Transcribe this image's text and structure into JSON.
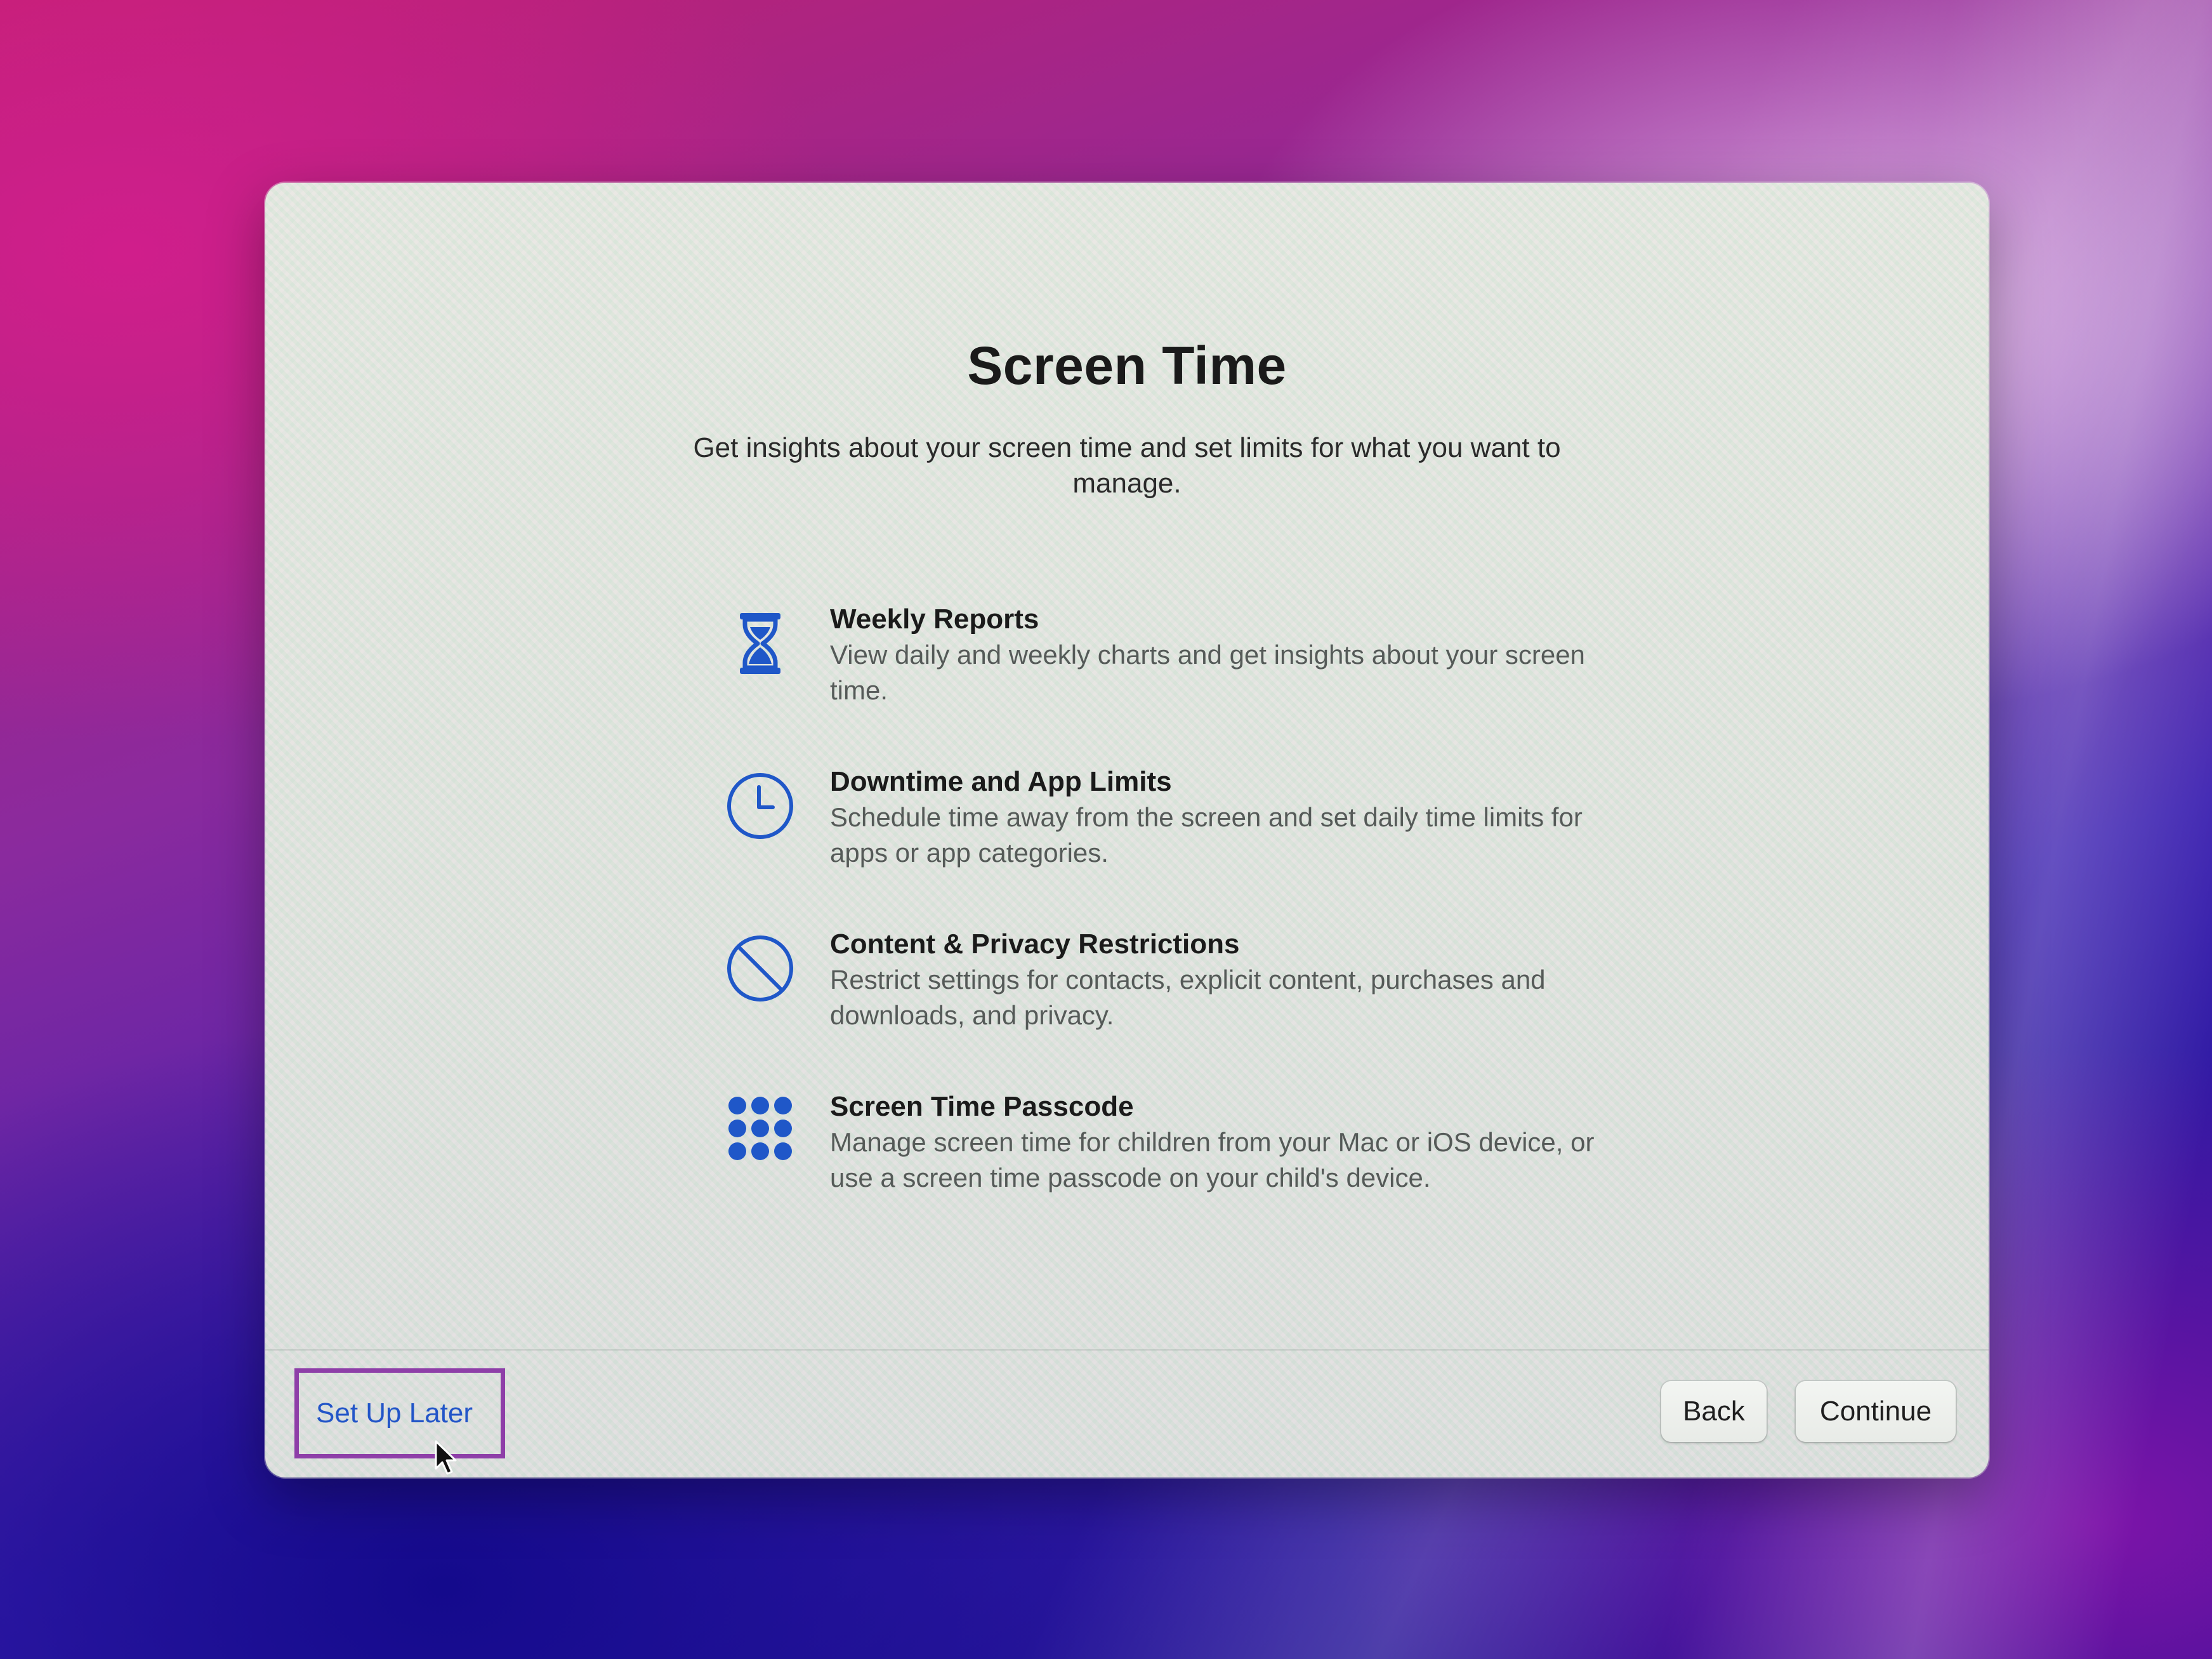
{
  "dialog": {
    "title": "Screen Time",
    "subtitle": "Get insights about your screen time and set limits for what you want to manage."
  },
  "features": [
    {
      "icon": "hourglass-icon",
      "title": "Weekly Reports",
      "description": "View daily and weekly charts and get insights about your screen time."
    },
    {
      "icon": "clock-icon",
      "title": "Downtime and App Limits",
      "description": "Schedule time away from the screen and set daily time limits for apps or app categories."
    },
    {
      "icon": "prohibited-icon",
      "title": "Content & Privacy Restrictions",
      "description": "Restrict settings for contacts, explicit content, purchases and downloads, and privacy."
    },
    {
      "icon": "keypad-icon",
      "title": "Screen Time Passcode",
      "description": "Manage screen time for children from your Mac or iOS device, or use a screen time passcode on your child's device."
    }
  ],
  "footer": {
    "setup_later_label": "Set Up Later",
    "back_label": "Back",
    "continue_label": "Continue"
  },
  "colors": {
    "accent": "#2255c8",
    "icon_blue": "#1f57c8",
    "highlight_frame": "#8e3ea8"
  }
}
